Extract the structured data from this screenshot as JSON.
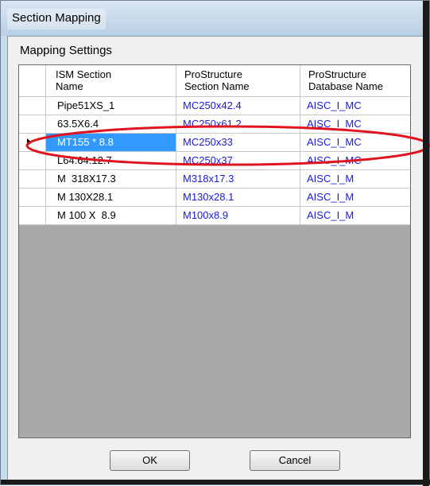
{
  "window": {
    "title": "Section Mapping"
  },
  "group": {
    "label": "Mapping Settings"
  },
  "grid": {
    "columns": [
      {
        "line1": "ISM Section",
        "line2": "Name"
      },
      {
        "line1": "ProStructure",
        "line2": "Section Name"
      },
      {
        "line1": "ProStructure",
        "line2": "Database Name"
      }
    ],
    "rows": [
      {
        "ism": "Pipe51XS_1",
        "section": "MC250x42.4",
        "database": "AISC_I_MC"
      },
      {
        "ism": "63.5X6.4",
        "section": "MC250x61.2",
        "database": "AISC_I_MC"
      },
      {
        "ism": "MT155 * 8.8",
        "section": "MC250x33",
        "database": "AISC_I_MC",
        "selected": true
      },
      {
        "ism": "L64:64:12.7",
        "section": "MC250x37",
        "database": "AISC_I_MC"
      },
      {
        "ism": "M  318X17.3",
        "section": "M318x17.3",
        "database": "AISC_I_M"
      },
      {
        "ism": "M 130X28.1",
        "section": "M130x28.1",
        "database": "AISC_I_M"
      },
      {
        "ism": "M 100 X  8.9",
        "section": "M100x8.9",
        "database": "AISC_I_M"
      }
    ],
    "selected_row_index": 2
  },
  "buttons": {
    "ok_label": "OK",
    "cancel_label": "Cancel"
  },
  "colors": {
    "selection": "#3399ff",
    "link_text": "#1a1adb",
    "annotation": "#e0141e",
    "grid_background": "#a9a9a9"
  }
}
